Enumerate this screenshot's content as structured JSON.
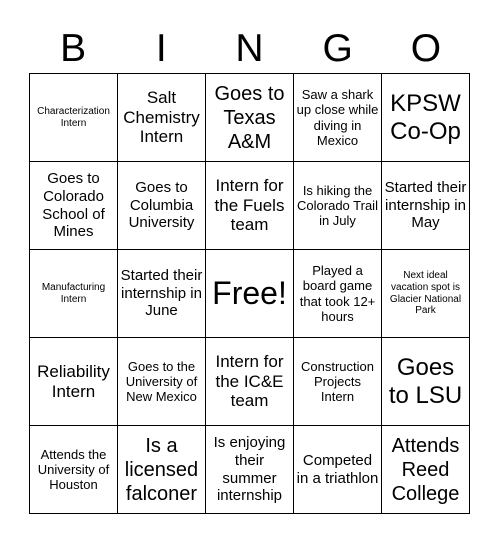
{
  "header": {
    "letters": [
      "B",
      "I",
      "N",
      "G",
      "O"
    ]
  },
  "board": {
    "cells": [
      [
        "Characterization Intern",
        "Salt Chemistry Intern",
        "Goes to Texas A&M",
        "Saw a shark up close while diving in Mexico",
        "KPSW Co-Op"
      ],
      [
        "Goes to Colorado School of Mines",
        "Goes to Columbia University",
        "Intern for the Fuels team",
        "Is hiking the Colorado Trail in July",
        "Started their internship in May"
      ],
      [
        "Manufacturing Intern",
        "Started their internship in June",
        "Free!",
        "Played a board game that took 12+ hours",
        "Next ideal vacation spot is Glacier National Park"
      ],
      [
        "Reliability Intern",
        "Goes to the University of New Mexico",
        "Intern for the IC&E team",
        "Construction Projects Intern",
        "Goes to LSU"
      ],
      [
        "Attends the University of Houston",
        "Is a licensed falconer",
        "Is enjoying their summer internship",
        "Competed in a triathlon",
        "Attends Reed College"
      ]
    ]
  }
}
